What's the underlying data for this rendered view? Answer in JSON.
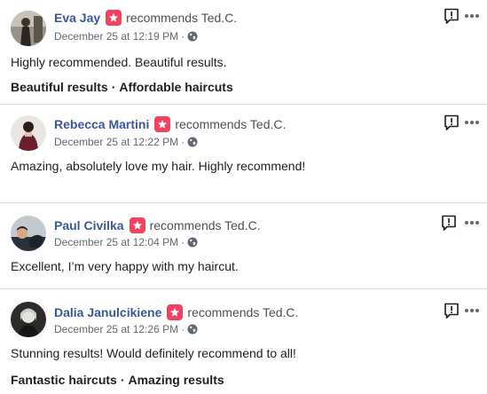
{
  "reviews": [
    {
      "name": "Eva Jay",
      "action": "recommends Ted.C.",
      "date": "December 25 at 12:19 PM",
      "separator": "·",
      "text": "Highly recommended. Beautiful results.",
      "tags": [
        "Beautiful results",
        "Affordable haircuts"
      ]
    },
    {
      "name": "Rebecca Martini",
      "action": "recommends Ted.C.",
      "date": "December 25 at 12:22 PM",
      "separator": "·",
      "text": "Amazing, absolutely love my hair. Highly recommend!",
      "tags": []
    },
    {
      "name": "Paul Civilka",
      "action": "recommends Ted.C.",
      "date": "December 25 at 12:04 PM",
      "separator": "·",
      "text": "Excellent, I’m very happy with my haircut.",
      "tags": []
    },
    {
      "name": "Dalia Janulcikiene",
      "action": "recommends Ted.C.",
      "date": "December 25 at 12:26 PM",
      "separator": "·",
      "text": "Stunning results! Would definitely recommend to all!",
      "tags": [
        "Fantastic haircuts",
        "Amazing results"
      ]
    }
  ],
  "tag_separator": "·",
  "icons": {
    "recommend": "recommend-badge-icon",
    "privacy": "globe-icon",
    "report": "report-icon",
    "more": "more-options-icon"
  },
  "colors": {
    "name": "#385898",
    "badge": "#f3425f",
    "meta": "#616770",
    "text": "#1c1e21"
  }
}
